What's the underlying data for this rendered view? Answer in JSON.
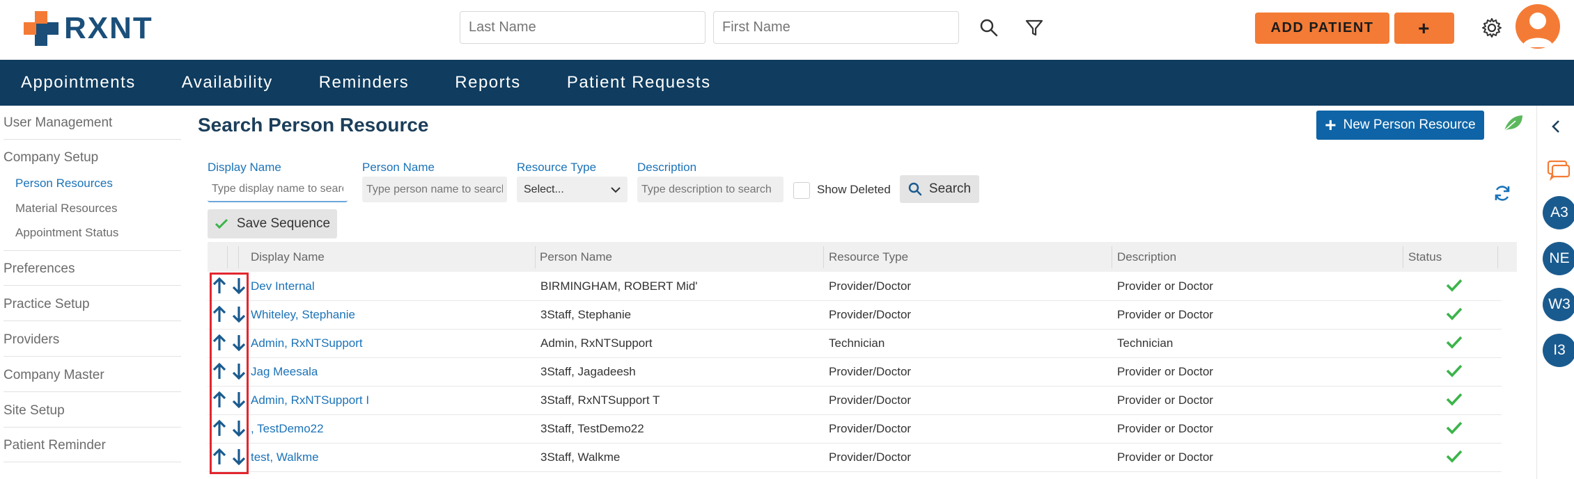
{
  "header": {
    "logo_text": "RXNT",
    "last_name_placeholder": "Last Name",
    "first_name_placeholder": "First Name",
    "add_patient_label": "ADD PATIENT",
    "plus_label": "+"
  },
  "nav": {
    "items": [
      {
        "label": "Appointments"
      },
      {
        "label": "Availability"
      },
      {
        "label": "Reminders"
      },
      {
        "label": "Reports"
      },
      {
        "label": "Patient Requests"
      }
    ]
  },
  "sidebar": {
    "items": [
      {
        "label": "User Management"
      },
      {
        "label": "Company Setup"
      },
      {
        "label": "Person Resources"
      },
      {
        "label": "Material Resources"
      },
      {
        "label": "Appointment Status"
      },
      {
        "label": "Preferences"
      },
      {
        "label": "Practice Setup"
      },
      {
        "label": "Providers"
      },
      {
        "label": "Company Master"
      },
      {
        "label": "Site Setup"
      },
      {
        "label": "Patient Reminder"
      }
    ]
  },
  "page": {
    "title": "Search Person Resource",
    "new_button_label": "New Person Resource",
    "filters": {
      "display_name_label": "Display Name",
      "display_name_placeholder": "Type display name to search",
      "person_name_label": "Person Name",
      "person_name_placeholder": "Type person name to search",
      "resource_type_label": "Resource Type",
      "resource_type_value": "Select...",
      "description_label": "Description",
      "description_placeholder": "Type description to search",
      "show_deleted_label": "Show Deleted",
      "search_label": "Search"
    },
    "save_sequence_label": "Save Sequence"
  },
  "table": {
    "headers": [
      "Display Name",
      "Person Name",
      "Resource Type",
      "Description",
      "Status"
    ],
    "rows": [
      {
        "display": "Dev Internal",
        "person": "BIRMINGHAM, ROBERT Mid'",
        "type": "Provider/Doctor",
        "desc": "Provider or Doctor"
      },
      {
        "display": "Whiteley, Stephanie",
        "person": "3Staff, Stephanie",
        "type": "Provider/Doctor",
        "desc": "Provider or Doctor"
      },
      {
        "display": "Admin, RxNTSupport",
        "person": "Admin, RxNTSupport",
        "type": "Technician",
        "desc": "Technician"
      },
      {
        "display": "Jag Meesala",
        "person": "3Staff, Jagadeesh",
        "type": "Provider/Doctor",
        "desc": "Provider or Doctor"
      },
      {
        "display": "Admin, RxNTSupport I",
        "person": "3Staff, RxNTSupport T",
        "type": "Provider/Doctor",
        "desc": "Provider or Doctor"
      },
      {
        "display": ", TestDemo22",
        "person": "3Staff, TestDemo22",
        "type": "Provider/Doctor",
        "desc": "Provider or Doctor"
      },
      {
        "display": "test, Walkme",
        "person": "3Staff, Walkme",
        "type": "Provider/Doctor",
        "desc": "Provider or Doctor"
      }
    ]
  },
  "right_rail": {
    "badges": [
      "A3",
      "NE",
      "W3",
      "I3"
    ]
  },
  "colors": {
    "brand_blue": "#0f3c5f",
    "accent_orange": "#f47b35",
    "link_blue": "#1b73b8",
    "status_green": "#3cb44b",
    "highlight_red": "#e2262e"
  }
}
